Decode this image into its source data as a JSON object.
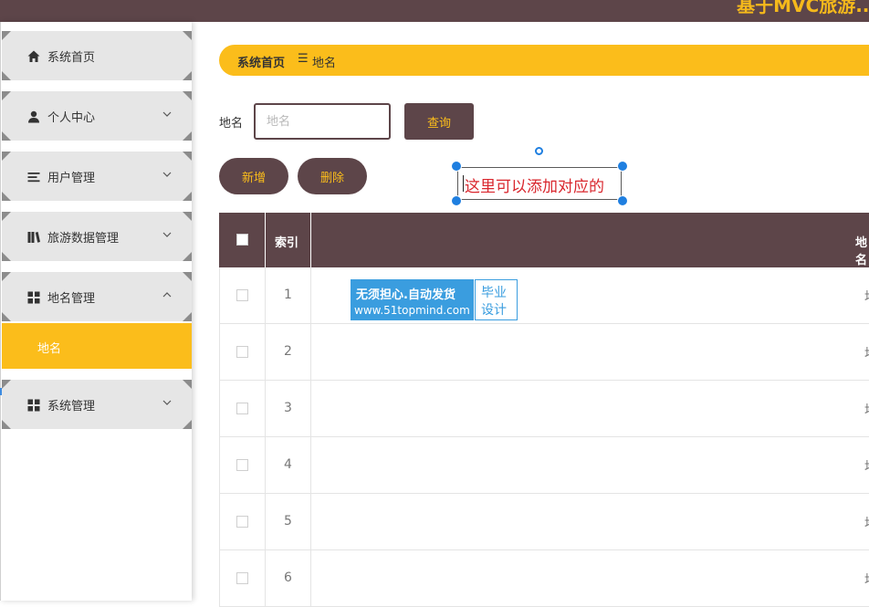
{
  "app": {
    "title": "基于MVC旅游..."
  },
  "sidebar": {
    "items": [
      {
        "label": "系统首页",
        "icon": "home-icon",
        "has_caret": false
      },
      {
        "label": "个人中心",
        "icon": "user-icon",
        "has_caret": true,
        "caret": "down"
      },
      {
        "label": "用户管理",
        "icon": "list-icon",
        "has_caret": true,
        "caret": "down"
      },
      {
        "label": "旅游数据管理",
        "icon": "books-icon",
        "has_caret": true,
        "caret": "down"
      },
      {
        "label": "地名管理",
        "icon": "grid-icon",
        "has_caret": true,
        "caret": "up"
      },
      {
        "label": "系统管理",
        "icon": "grid-icon",
        "has_caret": true,
        "caret": "down"
      }
    ],
    "active_sub": {
      "label": "地名"
    }
  },
  "breadcrumb": {
    "home": "系统首页",
    "separator": "☰",
    "current": "地名"
  },
  "search": {
    "label": "地名",
    "placeholder": "地名",
    "value": "",
    "button": "查询"
  },
  "actions": {
    "add": "新增",
    "delete": "删除"
  },
  "annotation": {
    "text": "这里可以添加对应的"
  },
  "table": {
    "headers": {
      "index": "索引",
      "name": "地名"
    },
    "rows": [
      {
        "index": "1",
        "name": "地"
      },
      {
        "index": "2",
        "name": "地"
      },
      {
        "index": "3",
        "name": "地"
      },
      {
        "index": "4",
        "name": "地"
      },
      {
        "index": "5",
        "name": "地"
      },
      {
        "index": "6",
        "name": "地"
      }
    ]
  },
  "watermark": {
    "line1": "无须担心.自动发货",
    "line2": "www.51topmind.com",
    "right1": "毕业",
    "right2": "设计"
  },
  "colors": {
    "primary": "#5d4549",
    "accent": "#fbbd1b",
    "annotation_text": "#d9272e",
    "handle": "#1f7fe0",
    "watermark": "#3a9ddf"
  }
}
